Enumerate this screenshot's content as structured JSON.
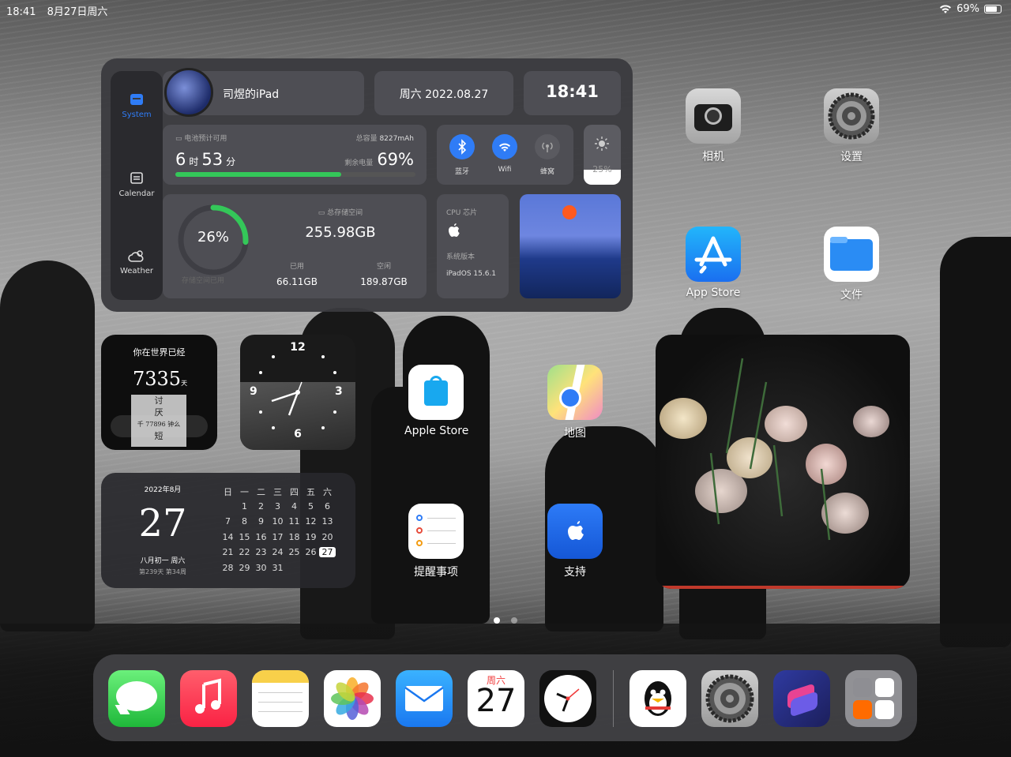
{
  "status_bar": {
    "time": "18:41",
    "date": "8月27日周六",
    "battery": "69%"
  },
  "system_widget": {
    "sidebar": [
      {
        "label": "System",
        "icon": "system-icon",
        "active": true
      },
      {
        "label": "Calendar",
        "icon": "calendar-icon",
        "active": false
      },
      {
        "label": "Weather",
        "icon": "weather-icon",
        "active": false
      }
    ],
    "device_name": "司煜的iPad",
    "date": "周六  2022.08.27",
    "time": "18:41",
    "battery": {
      "estimate_label": "电池预计可用",
      "hours": "6",
      "hours_unit": "时",
      "minutes": "53",
      "minutes_unit": "分",
      "capacity_label": "总容量",
      "capacity": "8227mAh",
      "remain_label": "剩余电量",
      "percent": "69%",
      "level": 0.69
    },
    "toggles": [
      {
        "label": "蓝牙",
        "icon": "bluetooth-icon",
        "on": true
      },
      {
        "label": "Wifi",
        "icon": "wifi-icon",
        "on": true
      },
      {
        "label": "蜂窝",
        "icon": "cellular-icon",
        "on": false
      }
    ],
    "brightness": {
      "value": "25%",
      "icon": "sun-icon",
      "level": 0.25
    },
    "storage": {
      "used_percent": "26%",
      "used_fraction": 0.26,
      "used_caption": "存储空间已用",
      "total_label": "总存储空间",
      "total": "255.98GB",
      "used_label": "已用",
      "used": "66.11GB",
      "free_label": "空闲",
      "free": "189.87GB"
    },
    "cpu": {
      "label": "CPU 芯片",
      "os_label": "系统版本",
      "os": "iPadOS 15.6.1"
    }
  },
  "days_widget": {
    "title": "你在世界已经",
    "days": "7335",
    "unit": "天",
    "note_lines": [
      "讨",
      "厌",
      "千 77896 钟么",
      "短"
    ]
  },
  "clock_widget": {
    "n12": "12",
    "n3": "3",
    "n6": "6",
    "n9": "9"
  },
  "calendar_widget": {
    "month_label": "2022年8月",
    "day": "27",
    "lunar": "八月初一  周六",
    "week_info": "第239天  第34周",
    "weekdays": [
      "日",
      "一",
      "二",
      "三",
      "四",
      "五",
      "六"
    ],
    "rows": [
      [
        "",
        "1",
        "2",
        "3",
        "4",
        "5",
        "6"
      ],
      [
        "7",
        "8",
        "9",
        "10",
        "11",
        "12",
        "13"
      ],
      [
        "14",
        "15",
        "16",
        "17",
        "18",
        "19",
        "20"
      ],
      [
        "21",
        "22",
        "23",
        "24",
        "25",
        "26",
        "27"
      ],
      [
        "28",
        "29",
        "30",
        "31",
        "",
        "",
        ""
      ]
    ],
    "today": "27"
  },
  "apps": {
    "camera": "相机",
    "settings": "设置",
    "app_store": "App Store",
    "files": "文件",
    "apple_store": "Apple Store",
    "maps": "地图",
    "reminders": "提醒事项",
    "support": "支持"
  },
  "dock": {
    "calendar_weekday": "周六",
    "calendar_day": "27",
    "items": [
      "messages-icon",
      "music-icon",
      "notes-icon",
      "photos-icon",
      "mail-icon",
      "calendar-icon",
      "clock-icon",
      "qq-icon",
      "settings-icon",
      "shortcuts-icon",
      "folder-icon"
    ]
  },
  "colors": {
    "accent_blue": "#2f7cf6",
    "battery_green": "#34c759",
    "widget_bg": "#3a3a3e"
  }
}
